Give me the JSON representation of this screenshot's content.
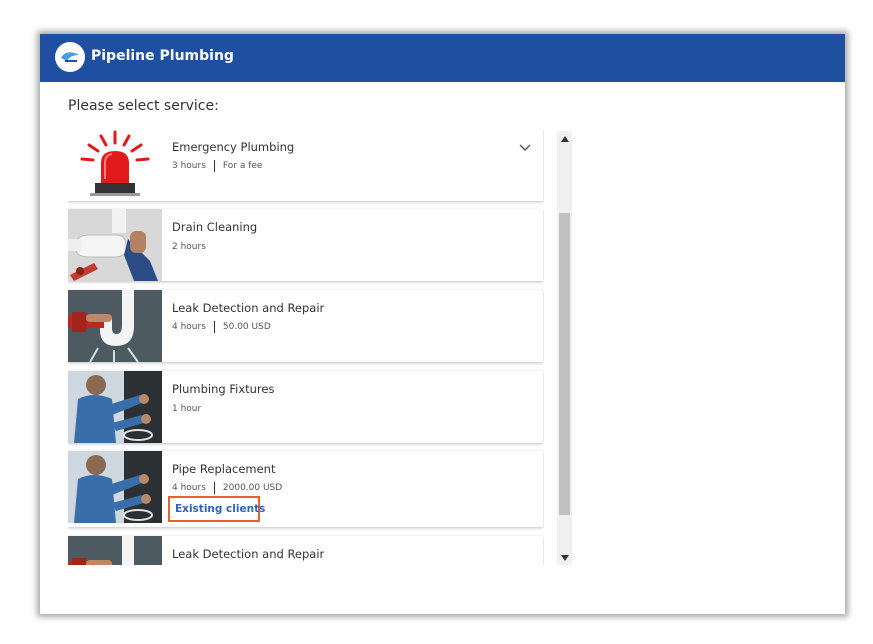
{
  "header": {
    "title": "Pipeline Plumbing",
    "logo_icon": "pipeline-plumbing-logo",
    "bg_color": "#1f4fa0"
  },
  "prompt": "Please select service:",
  "services": [
    {
      "name": "Emergency Plumbing",
      "duration": "3 hours",
      "price": "For a fee",
      "image": "red-siren-light",
      "expanded_indicator": "chevron-down-icon"
    },
    {
      "name": "Drain Cleaning",
      "duration": "2 hours",
      "image": "drain-pipe-wrench"
    },
    {
      "name": "Leak Detection and Repair",
      "duration": "4 hours",
      "price": "50.00 USD",
      "image": "leaking-pipe"
    },
    {
      "name": "Plumbing Fixtures",
      "duration": "1 hour",
      "image": "plumber-under-sink"
    },
    {
      "name": "Pipe Replacement",
      "duration": "4 hours",
      "price": "2000.00 USD",
      "image": "plumber-under-sink",
      "restriction": "Existing clients"
    },
    {
      "name": "Leak Detection and Repair",
      "image": "leaking-pipe"
    }
  ],
  "highlight_color": "#e8612c",
  "link_color": "#2c63c4"
}
